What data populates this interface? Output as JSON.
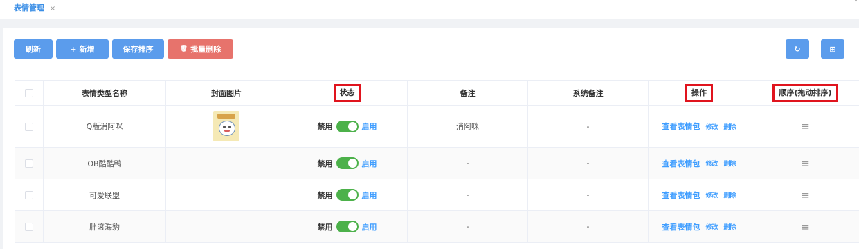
{
  "tab": {
    "label": "表情管理",
    "close": "×",
    "chevron": "˅"
  },
  "toolbar": {
    "refresh": "刷新",
    "add_icon": "+",
    "add": "新增",
    "save_sort": "保存排序",
    "bulk_delete_icon": "🗑",
    "bulk_delete": "批量删除",
    "reload_icon": "↻",
    "grid_icon": "⊞"
  },
  "table": {
    "headers": {
      "name": "表情类型名称",
      "cover": "封面图片",
      "status": "状态",
      "note": "备注",
      "system_note": "系统备注",
      "actions": "操作",
      "order": "顺序(拖动排序)"
    },
    "rows": [
      {
        "name": "Q版消阿咪",
        "has_cover": true,
        "status_off": "禁用",
        "status_on": "启用",
        "enabled": true,
        "note": "消阿咪",
        "system_note": "-",
        "view": "查看表情包",
        "edit": "修改",
        "delete": "删除",
        "drag": "≡"
      },
      {
        "name": "OB酷酷鸭",
        "has_cover": false,
        "status_off": "禁用",
        "status_on": "启用",
        "enabled": true,
        "note": "-",
        "system_note": "-",
        "view": "查看表情包",
        "edit": "修改",
        "delete": "删除",
        "drag": "≡"
      },
      {
        "name": "可爱联盟",
        "has_cover": false,
        "status_off": "禁用",
        "status_on": "启用",
        "enabled": true,
        "note": "-",
        "system_note": "-",
        "view": "查看表情包",
        "edit": "修改",
        "delete": "删除",
        "drag": "≡"
      },
      {
        "name": "胖滚海豹",
        "has_cover": false,
        "status_off": "禁用",
        "status_on": "启用",
        "enabled": true,
        "note": "-",
        "system_note": "-",
        "view": "查看表情包",
        "edit": "修改",
        "delete": "删除",
        "drag": "≡"
      }
    ]
  },
  "colors": {
    "primary": "#5b9cec",
    "danger": "#e7736c",
    "switch_on": "#4cb14a",
    "link": "#409eff",
    "highlight_box": "#e0141e"
  }
}
